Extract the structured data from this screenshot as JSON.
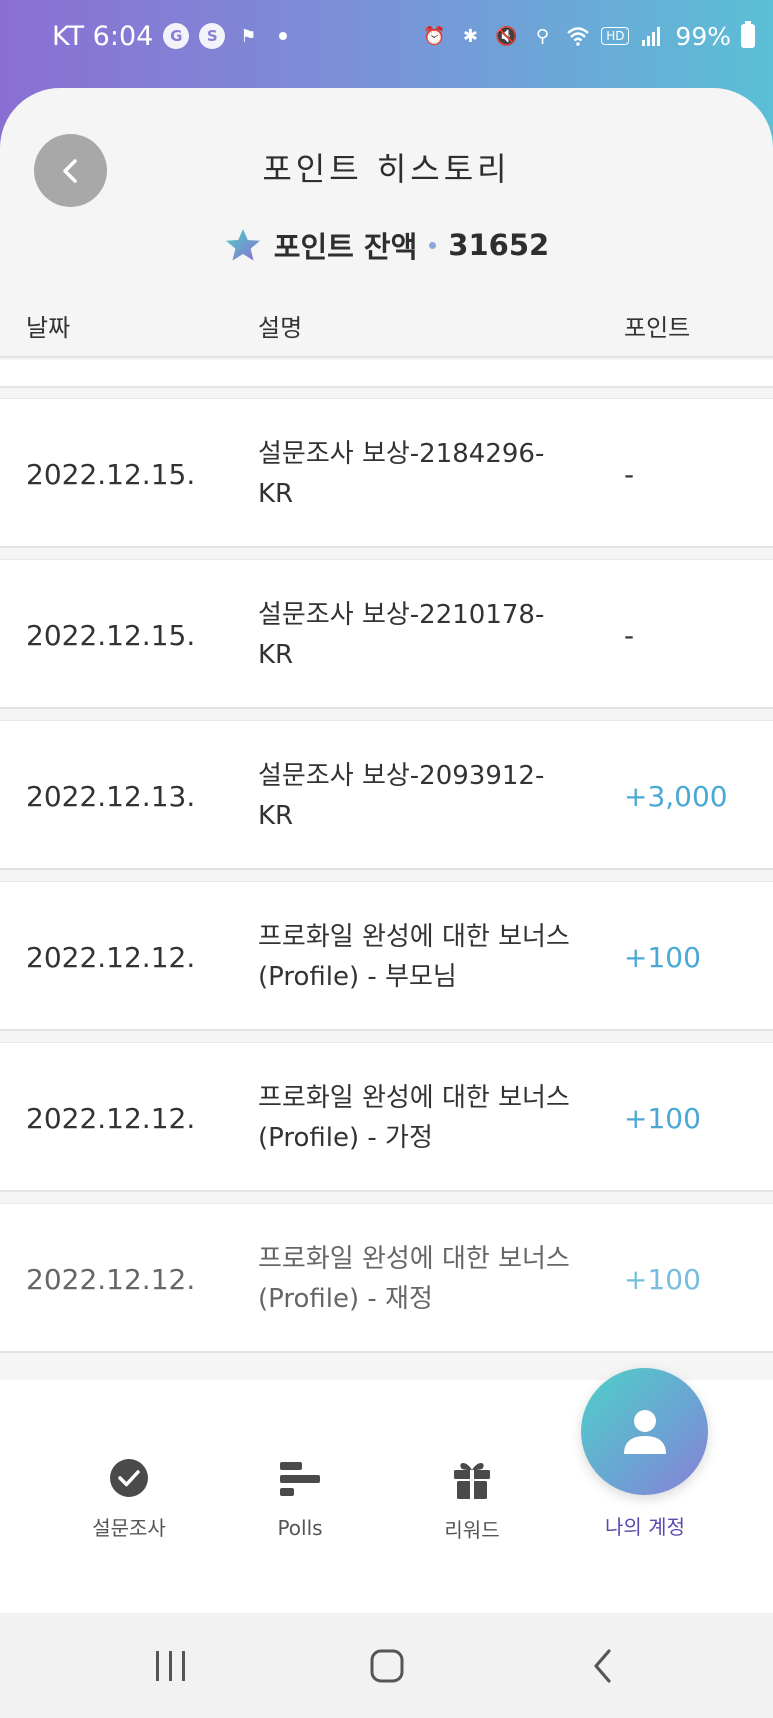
{
  "status_bar": {
    "carrier_time": "KT 6:04",
    "battery": "99%",
    "left_icons": [
      "g-icon",
      "s-icon",
      "flag-icon"
    ],
    "right_icons": [
      "alarm-icon",
      "bluetooth-icon",
      "mute-icon",
      "location-icon",
      "wifi-icon",
      "hd-icon",
      "signal-icon",
      "battery-icon"
    ]
  },
  "header": {
    "title": "포인트 히스토리",
    "balance_label": "포인트 잔액",
    "balance_value": "31652"
  },
  "table": {
    "columns": [
      "날짜",
      "설명",
      "포인트"
    ],
    "rows": [
      {
        "date": "2022.12.15.",
        "description": "설문조사 보상-2184296-KR",
        "points": "-"
      },
      {
        "date": "2022.12.15.",
        "description": "설문조사 보상-2210178-KR",
        "points": "-"
      },
      {
        "date": "2022.12.13.",
        "description": "설문조사 보상-2093912-KR",
        "points": "+3,000"
      },
      {
        "date": "2022.12.12.",
        "description": "프로화일 완성에 대한 보너스 (Profile) - 부모님",
        "points": "+100"
      },
      {
        "date": "2022.12.12.",
        "description": "프로화일 완성에 대한 보너스 (Profile) - 가정",
        "points": "+100"
      },
      {
        "date": "2022.12.12.",
        "description": "프로화일 완성에 대한 보너스 (Profile) - 재정",
        "points": "+100"
      }
    ]
  },
  "bottom_nav": {
    "items": [
      {
        "label": "설문조사",
        "icon": "check-circle-icon"
      },
      {
        "label": "Polls",
        "icon": "bars-icon"
      },
      {
        "label": "리워드",
        "icon": "gift-icon"
      },
      {
        "label": "나의 계정",
        "icon": "user-icon"
      }
    ],
    "active_index": 3
  },
  "colors": {
    "accent_gradient_start": "#8a6fd3",
    "accent_gradient_end": "#5bbfd6",
    "positive_points": "#4aa9d4",
    "active_nav": "#5b4bb0"
  }
}
